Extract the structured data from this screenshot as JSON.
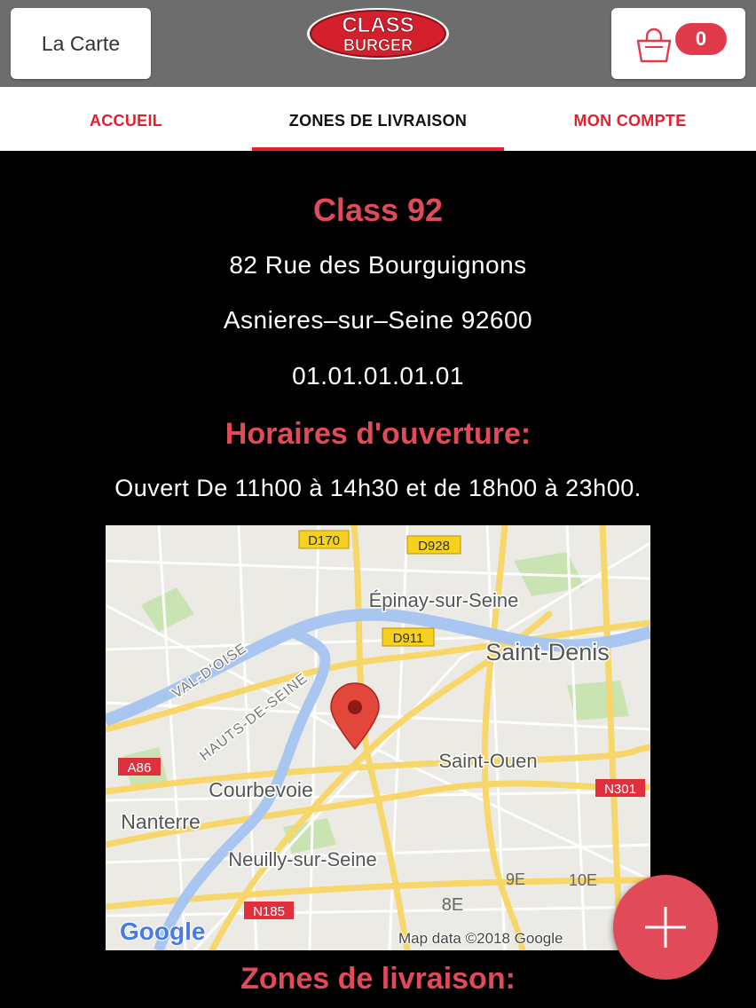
{
  "header": {
    "menu_button": "La Carte",
    "logo_line1": "CLASS",
    "logo_line2": "BURGER",
    "cart_count": "0"
  },
  "nav": {
    "tabs": [
      {
        "label": "ACCUEIL"
      },
      {
        "label": "ZONES DE LIVRAISON"
      },
      {
        "label": "MON COMPTE"
      }
    ],
    "active": 1
  },
  "restaurant": {
    "name": "Class 92",
    "street": "82 Rue des Bourguignons",
    "city": "Asnieres–sur–Seine 92600",
    "phone": "01.01.01.01.01"
  },
  "hours": {
    "heading": "Horaires d'ouverture:",
    "text": "Ouvert De 11h00 à 14h30 et de 18h00 à 23h00."
  },
  "map": {
    "labels": {
      "d170": "D170",
      "d928": "D928",
      "d911": "D911",
      "a86": "A86",
      "n301": "N301",
      "n185": "N185",
      "epinay": "Épinay-sur-Seine",
      "saint_denis": "Saint-Denis",
      "val_doise": "VAL-D'OISE",
      "hauts_de_seine": "HAUTS-DE-SEINE",
      "saint_ouen": "Saint-Ouen",
      "courbevoie": "Courbevoie",
      "nanterre": "Nanterre",
      "neuilly": "Neuilly-sur-Seine",
      "9e": "9E",
      "10e": "10E",
      "8e": "8E",
      "google": "Google",
      "attribution": "Map data ©2018 Google"
    }
  },
  "delivery": {
    "heading": "Zones de livraison:"
  },
  "colors": {
    "accent": "#e14a58",
    "nav_red": "#e0202e",
    "header_bg": "#6d6d6d"
  }
}
